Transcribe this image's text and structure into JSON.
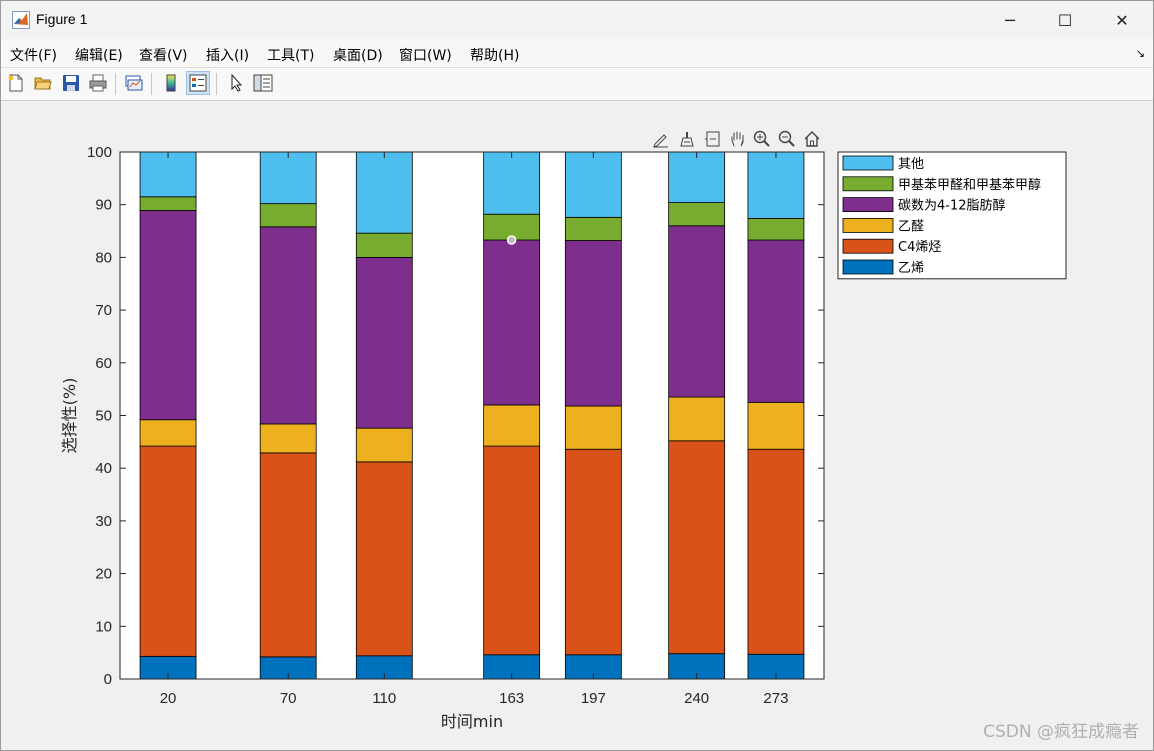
{
  "window": {
    "title": "Figure 1",
    "minimize_glyph": "─",
    "maximize_glyph": "☐",
    "close_glyph": "✕"
  },
  "menu": [
    "文件(F)",
    "编辑(E)",
    "查看(V)",
    "插入(I)",
    "工具(T)",
    "桌面(D)",
    "窗口(W)",
    "帮助(H)"
  ],
  "menu_corner_glyph": "↘",
  "toolbar_icons": [
    "new-figure-icon",
    "open-icon",
    "save-icon",
    "print-icon",
    "link-plot-icon",
    "colorbar-icon",
    "legend-icon",
    "edit-plot-arrow-icon",
    "property-inspector-icon"
  ],
  "axes_toolbar_icons": [
    "brush-edit-icon",
    "data-brush-icon",
    "datatip-icon",
    "pan-hand-icon",
    "zoom-in-icon",
    "zoom-out-icon",
    "home-restore-icon"
  ],
  "watermark": "CSDN @疯狂成瘾者",
  "colors": {
    "plot_bg": "#ffffff",
    "series": [
      "#0072BD",
      "#D95319",
      "#EDB120",
      "#7E2F8E",
      "#77AC30",
      "#4DBEEE"
    ]
  },
  "chart_data": {
    "type": "bar",
    "stacked": true,
    "categories": [
      "20",
      "70",
      "110",
      "163",
      "197",
      "240",
      "273"
    ],
    "x": [
      20,
      70,
      110,
      163,
      197,
      240,
      273
    ],
    "xlabel": "时间min",
    "ylabel": "选择性(%)",
    "ylim": [
      0,
      100
    ],
    "yticks": [
      0,
      10,
      20,
      30,
      40,
      50,
      60,
      70,
      80,
      90,
      100
    ],
    "grid": false,
    "legend_position": "outside-top-right",
    "series": [
      {
        "name": "乙烯",
        "values": [
          4.3,
          4.2,
          4.4,
          4.6,
          4.6,
          4.8,
          4.7
        ]
      },
      {
        "name": "C4烯烃",
        "values": [
          39.9,
          38.7,
          36.8,
          39.6,
          39.0,
          40.4,
          38.9
        ]
      },
      {
        "name": "乙醛",
        "values": [
          5.0,
          5.5,
          6.4,
          7.8,
          8.2,
          8.3,
          8.9
        ]
      },
      {
        "name": "碳数为4-12脂肪醇",
        "values": [
          39.7,
          37.4,
          32.4,
          31.3,
          31.4,
          32.5,
          30.8
        ]
      },
      {
        "name": "甲基苯甲醛和甲基苯甲醇",
        "values": [
          2.6,
          4.4,
          4.6,
          4.9,
          4.4,
          4.4,
          4.1
        ]
      },
      {
        "name": "其他",
        "values": [
          8.5,
          9.8,
          15.4,
          11.8,
          12.4,
          9.6,
          12.6
        ]
      }
    ]
  }
}
